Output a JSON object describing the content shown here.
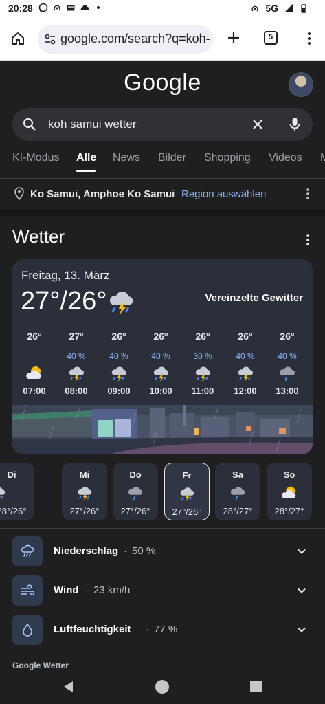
{
  "status_bar": {
    "time": "20:28",
    "network": "5G"
  },
  "browser": {
    "url": "google.com/search?q=koh-",
    "tab_count": "5"
  },
  "google": {
    "logo": "Google",
    "query": "koh samui wetter",
    "tabs": [
      "KI-Modus",
      "Alle",
      "News",
      "Bilder",
      "Shopping",
      "Videos",
      "M"
    ],
    "active_tab": "Alle",
    "location": "Ko Samui, Amphoe Ko Samui",
    "location_sep": "·",
    "region_link": "Region auswählen"
  },
  "weather": {
    "title": "Wetter",
    "date": "Freitag, 13. März",
    "temp": "27°/26°",
    "condition": "Vereinzelte Gewitter",
    "hourly": [
      {
        "temp": "26°",
        "precip": "",
        "icon": "partly-cloudy-sun-icon",
        "time": "07:00"
      },
      {
        "temp": "27°",
        "precip": "40 %",
        "icon": "thunderstorm-icon",
        "time": "08:00"
      },
      {
        "temp": "26°",
        "precip": "40 %",
        "icon": "thunderstorm-icon",
        "time": "09:00"
      },
      {
        "temp": "26°",
        "precip": "40 %",
        "icon": "thunderstorm-icon",
        "time": "10:00"
      },
      {
        "temp": "26°",
        "precip": "30 %",
        "icon": "thunderstorm-icon",
        "time": "11:00"
      },
      {
        "temp": "26°",
        "precip": "40 %",
        "icon": "thunderstorm-icon",
        "time": "12:00"
      },
      {
        "temp": "26°",
        "precip": "40 %",
        "icon": "rain-cloud-icon",
        "time": "13:00"
      }
    ],
    "days": [
      {
        "name": "Di",
        "icon": "thunderstorm-icon",
        "temps": "28°/26°",
        "selected": false
      },
      {
        "name": "Mi",
        "icon": "thunderstorm-icon",
        "temps": "27°/26°",
        "selected": false
      },
      {
        "name": "Do",
        "icon": "rain-cloud-icon",
        "temps": "27°/26°",
        "selected": false
      },
      {
        "name": "Fr",
        "icon": "thunderstorm-icon",
        "temps": "27°/26°",
        "selected": true
      },
      {
        "name": "Sa",
        "icon": "rain-cloud-icon",
        "temps": "28°/27°",
        "selected": false
      },
      {
        "name": "So",
        "icon": "partly-cloudy-sun-icon",
        "temps": "28°/27°",
        "selected": false
      }
    ],
    "metrics": [
      {
        "label": "Niederschlag",
        "value": "50 %",
        "icon": "rain-icon"
      },
      {
        "label": "Wind",
        "value": "23 km/h",
        "icon": "wind-icon"
      },
      {
        "label": "Luftfeuchtigkeit",
        "value": "77 %",
        "icon": "droplet-icon"
      }
    ],
    "metric_sep": "·",
    "source": "Google Wetter"
  },
  "colors": {
    "accent": "#8ab4f8",
    "card": "#2b2f3a",
    "page": "#1f1f1f"
  }
}
